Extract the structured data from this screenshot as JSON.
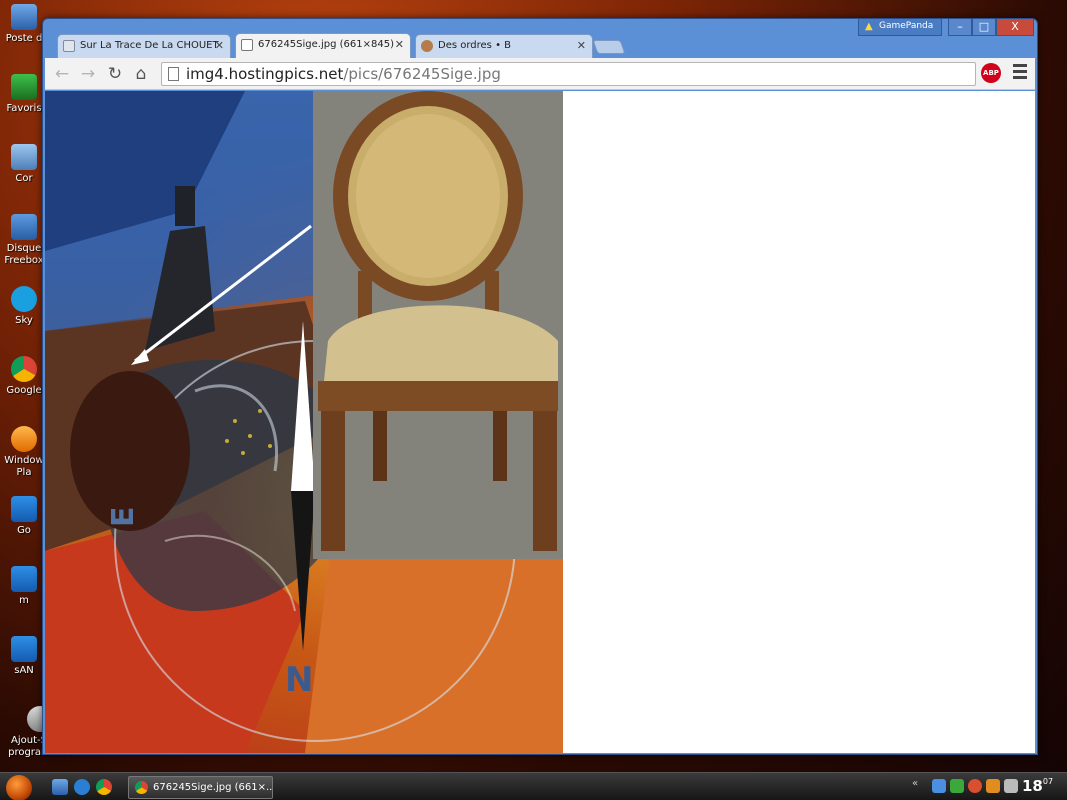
{
  "desktop": {
    "icons": [
      {
        "label": "Poste d",
        "icon": "computer-icon"
      },
      {
        "label": "Favoris",
        "icon": "favorites-icon"
      },
      {
        "label": "Cor",
        "icon": "recycle-bin-icon"
      },
      {
        "label": "Disque Freebox",
        "icon": "drive-icon"
      },
      {
        "label": "Sky",
        "icon": "skype-icon"
      },
      {
        "label": "Google",
        "icon": "chrome-icon"
      },
      {
        "label": "Window Pla",
        "icon": "media-player-icon"
      },
      {
        "label": "Go",
        "icon": "folder-icon"
      },
      {
        "label": "m",
        "icon": "folder-icon"
      },
      {
        "label": "sAN",
        "icon": "folder-icon"
      },
      {
        "label": "Ajout-Su de programmes",
        "icon": "music-icon"
      }
    ]
  },
  "browser": {
    "tabs": [
      {
        "label": "Sur La Trace De La CHOUET",
        "active": false,
        "icon": "owl-favicon-icon"
      },
      {
        "label": "676245Sige.jpg (661×845)",
        "active": true,
        "icon": "page-favicon-icon"
      },
      {
        "label": "Des ordres • B",
        "active": false,
        "icon": "butterfly-favicon-icon"
      }
    ],
    "profile_label": "GamePanda",
    "window_controls": {
      "minimize": "–",
      "maximize": "□",
      "close": "X"
    },
    "url": {
      "host": "img4.hostingpics.net",
      "path": "/pics/676245Sige.jpg"
    },
    "abp_label": "ABP"
  },
  "taskbar": {
    "task_label": "676245Sige.jpg (661×...",
    "clock_hour": "18",
    "clock_minute": "07"
  },
  "colors": {
    "window_frame": "#5b8fd6",
    "close_button": "#c74a3a",
    "abp_badge": "#d0021b",
    "chair_background": "#84837b"
  }
}
